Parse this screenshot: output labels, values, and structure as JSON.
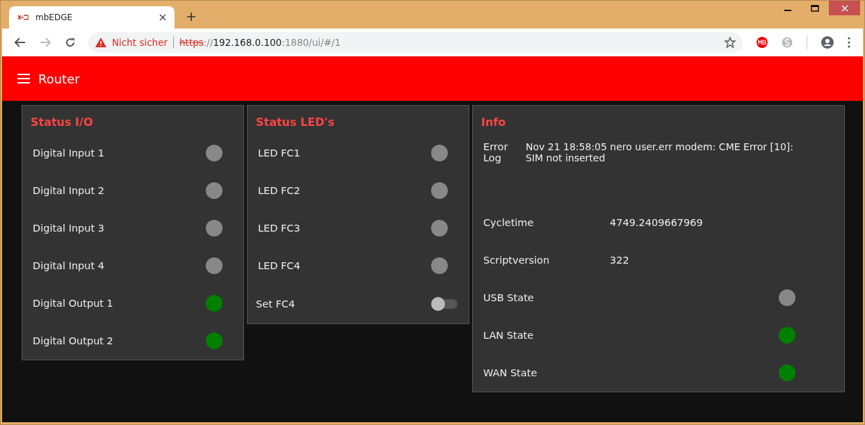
{
  "browser": {
    "tab": {
      "title": "mbEDGE"
    },
    "address": {
      "security": "Nicht sicher",
      "scheme": "https",
      "separator": "://",
      "host": "192.168.0.100",
      "path": ":1880/ui/#/1"
    }
  },
  "header": {
    "title": "Router"
  },
  "cards": [
    {
      "title": "Status I/O",
      "rows": [
        {
          "kind": "indicator",
          "label": "Digital Input 1",
          "on": false
        },
        {
          "kind": "indicator",
          "label": "Digital Input 2",
          "on": false
        },
        {
          "kind": "indicator",
          "label": "Digital Input 3",
          "on": false
        },
        {
          "kind": "indicator",
          "label": "Digital Input 4",
          "on": false
        },
        {
          "kind": "indicator",
          "label": "Digital Output 1",
          "on": true
        },
        {
          "kind": "indicator",
          "label": "Digital Output 2",
          "on": true
        }
      ]
    },
    {
      "title": "Status LED's",
      "rows": [
        {
          "kind": "indicator",
          "label": "LED FC1",
          "on": false
        },
        {
          "kind": "indicator",
          "label": "LED FC2",
          "on": false
        },
        {
          "kind": "indicator",
          "label": "LED FC3",
          "on": false
        },
        {
          "kind": "indicator",
          "label": "LED FC4",
          "on": false
        },
        {
          "kind": "switch",
          "label": "Set FC4",
          "on": false
        }
      ]
    },
    {
      "title": "Info",
      "rows": [
        {
          "kind": "log",
          "label": "Error Log",
          "value": "Nov 21 18:58:05 nero user.err modem: CME Error [10]: SIM not inserted"
        },
        {
          "kind": "text",
          "label": "Cycletime",
          "value": "4749.2409667969"
        },
        {
          "kind": "text",
          "label": "Scriptversion",
          "value": "322"
        },
        {
          "kind": "indicator",
          "label": "USB State",
          "on": false
        },
        {
          "kind": "indicator",
          "label": "LAN State",
          "on": true
        },
        {
          "kind": "indicator",
          "label": "WAN State",
          "on": true
        }
      ]
    }
  ]
}
